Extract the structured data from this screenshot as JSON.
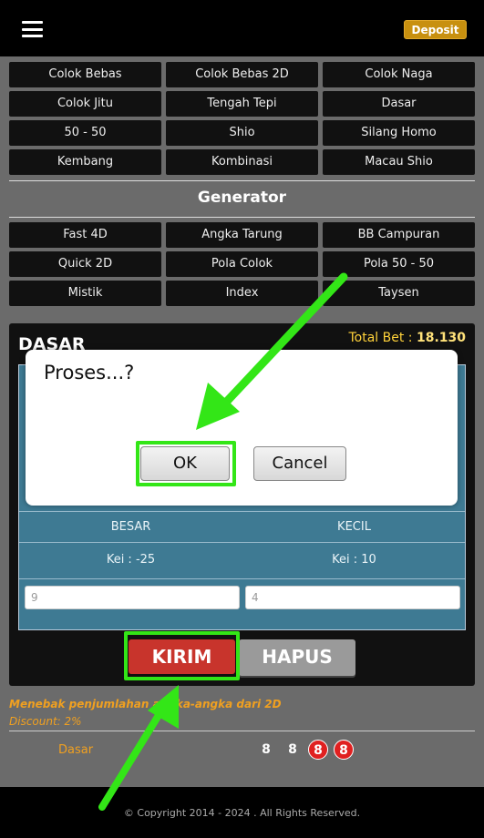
{
  "header": {
    "deposit_label": "Deposit"
  },
  "games": [
    "Colok Bebas",
    "Colok Bebas 2D",
    "Colok Naga",
    "Colok Jitu",
    "Tengah Tepi",
    "Dasar",
    "50 - 50",
    "Shio",
    "Silang Homo",
    "Kembang",
    "Kombinasi",
    "Macau Shio"
  ],
  "generator": {
    "title": "Generator",
    "items": [
      "Fast 4D",
      "Angka Tarung",
      "BB Campuran",
      "Quick 2D",
      "Pola Colok",
      "Pola 50 - 50",
      "Mistik",
      "Index",
      "Taysen"
    ]
  },
  "panel": {
    "title": "DASAR",
    "total_label": "Total Bet :",
    "total_value": "18.130",
    "besar_label": "BESAR",
    "kecil_label": "KECIL",
    "besar_kei": "Kei : -25",
    "kecil_kei": "Kei : 10",
    "besar_value": "9",
    "kecil_value": "4"
  },
  "actions": {
    "submit_label": "KIRIM",
    "clear_label": "HAPUS"
  },
  "info": {
    "description": "Menebak penjumlahan angka-angka dari 2D",
    "discount": "Discount: 2%"
  },
  "result": {
    "label": "Dasar",
    "numbers": [
      "8",
      "8",
      "8",
      "8"
    ]
  },
  "footer": {
    "copyright": "© Copyright 2014 - 2024 . All Rights Reserved."
  },
  "dialog": {
    "message": "Proses...?",
    "ok_label": "OK",
    "cancel_label": "Cancel"
  },
  "colors": {
    "accent_green": "#33e617",
    "deposit": "#c8900f",
    "kirim": "#c8342c",
    "panel_blue": "#3e7a93"
  }
}
